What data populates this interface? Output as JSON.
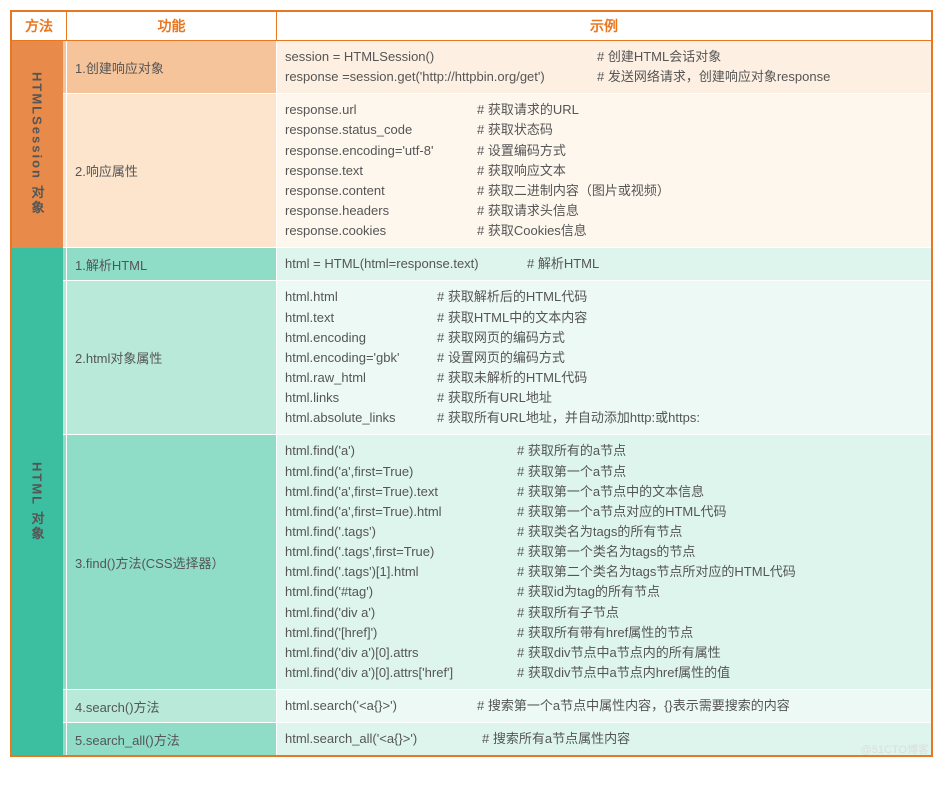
{
  "header": {
    "method": "方法",
    "function": "功能",
    "example": "示例"
  },
  "groups": [
    {
      "vhead": "HTMLSession 对象",
      "theme": "orange",
      "rows": [
        {
          "func": "1.创建响应对象",
          "lines": [
            {
              "code": "session = HTMLSession()",
              "cmt": "# 创建HTML会话对象"
            },
            {
              "code": "response =session.get('http://httpbin.org/get')",
              "cmt": "# 发送网络请求，创建响应对象response"
            }
          ],
          "codeMin": "300px"
        },
        {
          "func": "2.响应属性",
          "lines": [
            {
              "code": "response.url",
              "cmt": "# 获取请求的URL"
            },
            {
              "code": "response.status_code",
              "cmt": "# 获取状态码"
            },
            {
              "code": "response.encoding='utf-8'",
              "cmt": "# 设置编码方式"
            },
            {
              "code": "response.text",
              "cmt": "# 获取响应文本"
            },
            {
              "code": "response.content",
              "cmt": "# 获取二进制内容（图片或视频）"
            },
            {
              "code": "response.headers",
              "cmt": "# 获取请求头信息"
            },
            {
              "code": "response.cookies",
              "cmt": "# 获取Cookies信息"
            }
          ],
          "codeMin": "180px"
        }
      ]
    },
    {
      "vhead": "HTML 对象",
      "theme": "teal",
      "rows": [
        {
          "func": "1.解析HTML",
          "lines": [
            {
              "code": "html = HTML(html=response.text)",
              "cmt": "# 解析HTML"
            }
          ],
          "codeMin": "230px"
        },
        {
          "func": "2.html对象属性",
          "lines": [
            {
              "code": "html.html",
              "cmt": "# 获取解析后的HTML代码"
            },
            {
              "code": "html.text",
              "cmt": "# 获取HTML中的文本内容"
            },
            {
              "code": "html.encoding",
              "cmt": "# 获取网页的编码方式"
            },
            {
              "code": "html.encoding='gbk'",
              "cmt": "# 设置网页的编码方式"
            },
            {
              "code": "html.raw_html",
              "cmt": "# 获取未解析的HTML代码"
            },
            {
              "code": "html.links",
              "cmt": "# 获取所有URL地址"
            },
            {
              "code": "html.absolute_links",
              "cmt": "# 获取所有URL地址，并自动添加http:或https:"
            }
          ],
          "codeMin": "140px"
        },
        {
          "func": "3.find()方法(CSS选择器）",
          "lines": [
            {
              "code": "html.find('a')",
              "cmt": "# 获取所有的a节点"
            },
            {
              "code": "html.find('a',first=True)",
              "cmt": "# 获取第一个a节点"
            },
            {
              "code": "html.find('a',first=True).text",
              "cmt": "# 获取第一个a节点中的文本信息"
            },
            {
              "code": "html.find('a',first=True).html",
              "cmt": "# 获取第一个a节点对应的HTML代码"
            },
            {
              "code": "html.find('.tags')",
              "cmt": "# 获取类名为tags的所有节点"
            },
            {
              "code": "html.find('.tags',first=True)",
              "cmt": "# 获取第一个类名为tags的节点"
            },
            {
              "code": "html.find('.tags')[1].html",
              "cmt": "# 获取第二个类名为tags节点所对应的HTML代码"
            },
            {
              "code": "html.find('#tag')",
              "cmt": "# 获取id为tag的所有节点"
            },
            {
              "code": "html.find('div a')",
              "cmt": "# 获取所有子节点"
            },
            {
              "code": "html.find('[href]')",
              "cmt": "# 获取所有带有href属性的节点"
            },
            {
              "code": "html.find('div a')[0].attrs",
              "cmt": "# 获取div节点中a节点内的所有属性"
            },
            {
              "code": "html.find('div a')[0].attrs['href']",
              "cmt": "# 获取div节点中a节点内href属性的值"
            }
          ],
          "codeMin": "220px"
        },
        {
          "func": "4.search()方法",
          "lines": [
            {
              "code": "html.search('<a{}>')",
              "cmt": "# 搜索第一个a节点中属性内容，{}表示需要搜索的内容"
            }
          ],
          "codeMin": "180px"
        },
        {
          "func": "5.search_all()方法",
          "lines": [
            {
              "code": "html.search_all('<a{}>')",
              "cmt": "# 搜索所有a节点属性内容"
            }
          ],
          "codeMin": "185px"
        }
      ]
    }
  ],
  "watermark": "@51CTO博客"
}
